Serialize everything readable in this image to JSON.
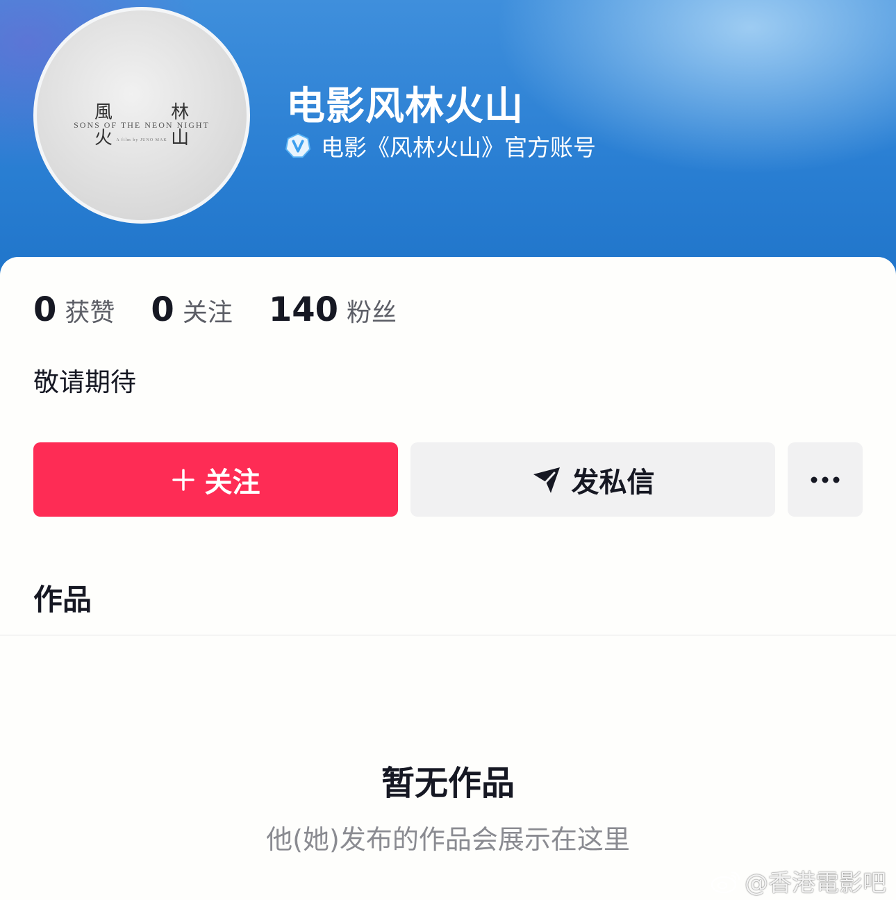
{
  "profile": {
    "avatar_title_cn": "風 林 火 山",
    "avatar_title_en": "SONS OF THE NEON NIGHT",
    "avatar_credit": "A film by JUNO MAK",
    "name": "电影风林火山",
    "verified_text": "电影《风林火山》官方账号",
    "bio": "敬请期待"
  },
  "stats": [
    {
      "value": "0",
      "label": "获赞"
    },
    {
      "value": "0",
      "label": "关注"
    },
    {
      "value": "140",
      "label": "粉丝"
    }
  ],
  "actions": {
    "follow_label": "关注",
    "message_label": "发私信"
  },
  "works": {
    "title": "作品",
    "empty_title": "暂无作品",
    "empty_subtitle": "他(她)发布的作品会展示在这里"
  },
  "watermark": "@香港電影吧",
  "colors": {
    "follow_button": "#fe2c55",
    "secondary_button": "#f1f1f2",
    "header_blue": "#2a7fd3",
    "verify_badge": "#5ab4f5"
  },
  "icons": {
    "verify": "verified-v-icon",
    "follow": "plus-icon",
    "message": "send-icon",
    "more": "more-dots-icon",
    "watermark": "weibo-icon"
  }
}
